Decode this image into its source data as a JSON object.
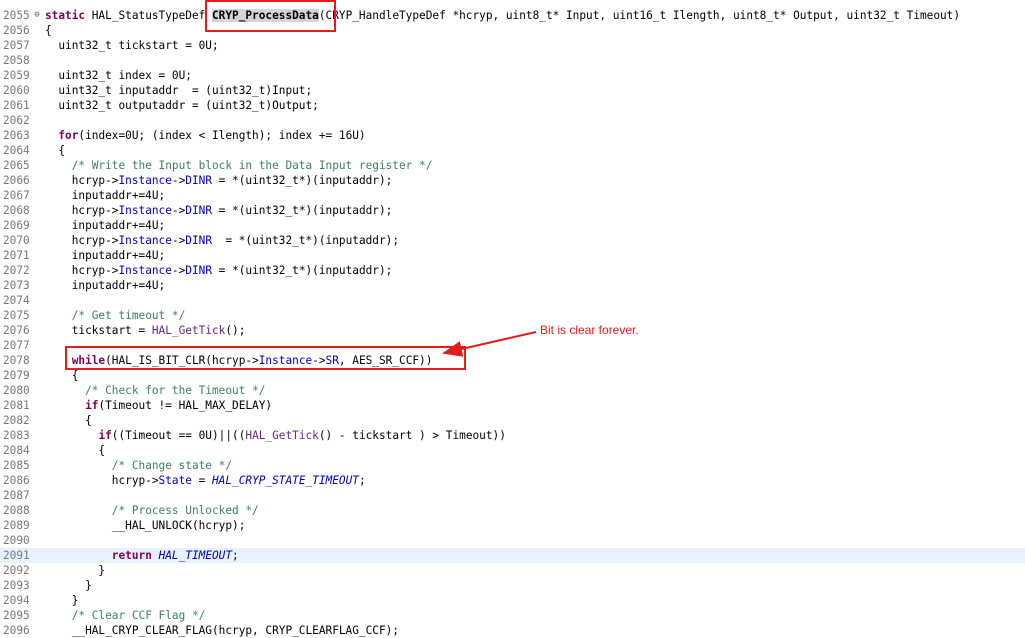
{
  "annotation": {
    "note": "Bit is clear forever."
  },
  "lines": [
    {
      "num": "2055",
      "fold": "⊖",
      "segments": [
        {
          "t": "static",
          "c": "kw"
        },
        {
          "t": " HAL_StatusTypeDef "
        },
        {
          "t": "CRYP_ProcessData",
          "c": "sel"
        },
        {
          "t": "(CRYP_HandleTypeDef *hcryp, uint8_t* Input, uint16_t Ilength, uint8_t* Output, uint32_t Timeout)"
        }
      ]
    },
    {
      "num": "2056",
      "segments": [
        {
          "t": "{"
        }
      ]
    },
    {
      "num": "2057",
      "segments": [
        {
          "t": "  uint32_t tickstart = 0U;"
        }
      ]
    },
    {
      "num": "2058",
      "segments": []
    },
    {
      "num": "2059",
      "segments": [
        {
          "t": "  uint32_t index = 0U;"
        }
      ]
    },
    {
      "num": "2060",
      "segments": [
        {
          "t": "  uint32_t inputaddr  = (uint32_t)Input;"
        }
      ]
    },
    {
      "num": "2061",
      "segments": [
        {
          "t": "  uint32_t outputaddr = (uint32_t)Output;"
        }
      ]
    },
    {
      "num": "2062",
      "segments": []
    },
    {
      "num": "2063",
      "segments": [
        {
          "t": "  "
        },
        {
          "t": "for",
          "c": "kw"
        },
        {
          "t": "(index=0U; (index < Ilength); index += 16U)"
        }
      ]
    },
    {
      "num": "2064",
      "segments": [
        {
          "t": "  {"
        }
      ]
    },
    {
      "num": "2065",
      "segments": [
        {
          "t": "    "
        },
        {
          "t": "/* Write the Input block in the Data Input register */",
          "c": "cm"
        }
      ]
    },
    {
      "num": "2066",
      "segments": [
        {
          "t": "    hcryp->"
        },
        {
          "t": "Instance",
          "c": "fld"
        },
        {
          "t": "->"
        },
        {
          "t": "DINR",
          "c": "fld"
        },
        {
          "t": " = *(uint32_t*)(inputaddr);"
        }
      ]
    },
    {
      "num": "2067",
      "segments": [
        {
          "t": "    inputaddr+=4U;"
        }
      ]
    },
    {
      "num": "2068",
      "segments": [
        {
          "t": "    hcryp->"
        },
        {
          "t": "Instance",
          "c": "fld"
        },
        {
          "t": "->"
        },
        {
          "t": "DINR",
          "c": "fld"
        },
        {
          "t": " = *(uint32_t*)(inputaddr);"
        }
      ]
    },
    {
      "num": "2069",
      "segments": [
        {
          "t": "    inputaddr+=4U;"
        }
      ]
    },
    {
      "num": "2070",
      "segments": [
        {
          "t": "    hcryp->"
        },
        {
          "t": "Instance",
          "c": "fld"
        },
        {
          "t": "->"
        },
        {
          "t": "DINR",
          "c": "fld"
        },
        {
          "t": "  = *(uint32_t*)(inputaddr);"
        }
      ]
    },
    {
      "num": "2071",
      "segments": [
        {
          "t": "    inputaddr+=4U;"
        }
      ]
    },
    {
      "num": "2072",
      "segments": [
        {
          "t": "    hcryp->"
        },
        {
          "t": "Instance",
          "c": "fld"
        },
        {
          "t": "->"
        },
        {
          "t": "DINR",
          "c": "fld"
        },
        {
          "t": " = *(uint32_t*)(inputaddr);"
        }
      ]
    },
    {
      "num": "2073",
      "segments": [
        {
          "t": "    inputaddr+=4U;"
        }
      ]
    },
    {
      "num": "2074",
      "segments": []
    },
    {
      "num": "2075",
      "segments": [
        {
          "t": "    "
        },
        {
          "t": "/* Get timeout */",
          "c": "cm"
        }
      ]
    },
    {
      "num": "2076",
      "segments": [
        {
          "t": "    tickstart = "
        },
        {
          "t": "HAL_GetTick",
          "c": "mac"
        },
        {
          "t": "();"
        }
      ]
    },
    {
      "num": "2077",
      "segments": []
    },
    {
      "num": "2078",
      "segments": [
        {
          "t": "    "
        },
        {
          "t": "while",
          "c": "kw"
        },
        {
          "t": "(HAL_IS_BIT_CLR(hcryp->"
        },
        {
          "t": "Instance",
          "c": "fld"
        },
        {
          "t": "->"
        },
        {
          "t": "SR",
          "c": "fld"
        },
        {
          "t": ", AES_SR_CCF))"
        }
      ]
    },
    {
      "num": "2079",
      "segments": [
        {
          "t": "    {"
        }
      ]
    },
    {
      "num": "2080",
      "segments": [
        {
          "t": "      "
        },
        {
          "t": "/* Check for the Timeout */",
          "c": "cm"
        }
      ]
    },
    {
      "num": "2081",
      "segments": [
        {
          "t": "      "
        },
        {
          "t": "if",
          "c": "kw"
        },
        {
          "t": "(Timeout != HAL_MAX_DELAY)"
        }
      ]
    },
    {
      "num": "2082",
      "segments": [
        {
          "t": "      {"
        }
      ]
    },
    {
      "num": "2083",
      "segments": [
        {
          "t": "        "
        },
        {
          "t": "if",
          "c": "kw"
        },
        {
          "t": "((Timeout == 0U)||(("
        },
        {
          "t": "HAL_GetTick",
          "c": "mac"
        },
        {
          "t": "() - tickstart ) > Timeout))"
        }
      ]
    },
    {
      "num": "2084",
      "segments": [
        {
          "t": "        {"
        }
      ]
    },
    {
      "num": "2085",
      "segments": [
        {
          "t": "          "
        },
        {
          "t": "/* Change state */",
          "c": "cm"
        }
      ]
    },
    {
      "num": "2086",
      "segments": [
        {
          "t": "          hcryp->"
        },
        {
          "t": "State",
          "c": "fld"
        },
        {
          "t": " = "
        },
        {
          "t": "HAL_CRYP_STATE_TIMEOUT",
          "c": "enum"
        },
        {
          "t": ";"
        }
      ]
    },
    {
      "num": "2087",
      "segments": []
    },
    {
      "num": "2088",
      "segments": [
        {
          "t": "          "
        },
        {
          "t": "/* Process Unlocked */",
          "c": "cm"
        }
      ]
    },
    {
      "num": "2089",
      "segments": [
        {
          "t": "          __HAL_UNLOCK(hcryp);"
        }
      ]
    },
    {
      "num": "2090",
      "segments": []
    },
    {
      "num": "2091",
      "current": true,
      "segments": [
        {
          "t": "          "
        },
        {
          "t": "return",
          "c": "kw"
        },
        {
          "t": " "
        },
        {
          "t": "HAL_TIMEOUT",
          "c": "enum"
        },
        {
          "t": ";"
        }
      ]
    },
    {
      "num": "2092",
      "segments": [
        {
          "t": "        }"
        }
      ]
    },
    {
      "num": "2093",
      "segments": [
        {
          "t": "      }"
        }
      ]
    },
    {
      "num": "2094",
      "segments": [
        {
          "t": "    }"
        }
      ]
    },
    {
      "num": "2095",
      "segments": [
        {
          "t": "    "
        },
        {
          "t": "/* Clear CCF Flag */",
          "c": "cm"
        }
      ]
    },
    {
      "num": "2096",
      "segments": [
        {
          "t": "    __HAL_CRYP_CLEAR_FLAG(hcryp, CRYP_CLEARFLAG_CCF);"
        }
      ]
    }
  ]
}
